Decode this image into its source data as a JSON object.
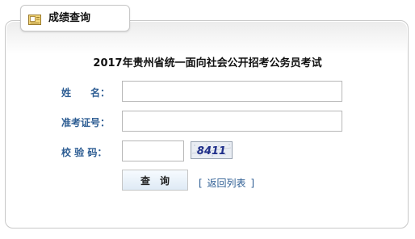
{
  "tab": {
    "title": "成绩查询",
    "icon": "document-icon"
  },
  "exam_title": "2017年贵州省统一面向社会公开招考公务员考试",
  "form": {
    "name_label": "姓　　名：",
    "name_value": "",
    "id_label": "准考证号：",
    "id_value": "",
    "code_label": "校 验 码：",
    "code_value": "",
    "captcha_text": "8411"
  },
  "actions": {
    "query_label": "查询",
    "back_bracket_open": "[",
    "back_label": "返回列表",
    "back_bracket_close": "]"
  },
  "colors": {
    "label_blue": "#2d5d93",
    "border": "#c8c8c8",
    "captcha_text": "#1f2f8a"
  }
}
